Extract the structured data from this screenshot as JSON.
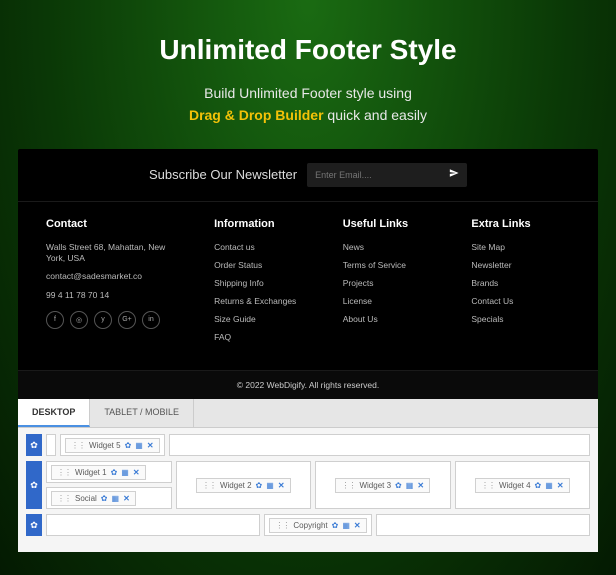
{
  "hero": {
    "title": "Unlimited Footer Style",
    "line1": "Build Unlimited Footer style using",
    "highlight": "Drag & Drop Builder",
    "line2_after": " quick and easily"
  },
  "newsletter": {
    "title": "Subscribe Our Newsletter",
    "placeholder": "Enter Email....",
    "submit_icon": "send-icon"
  },
  "footer_cols": {
    "contact": {
      "heading": "Contact",
      "address": "Walls Street 68, Mahattan, New York, USA",
      "email": "contact@sadesmarket.co",
      "phone": "99 4 11 78 70 14"
    },
    "information": {
      "heading": "Information",
      "items": [
        "Contact us",
        "Order Status",
        "Shipping Info",
        "Returns & Exchanges",
        "Size Guide",
        "FAQ"
      ]
    },
    "useful": {
      "heading": "Useful Links",
      "items": [
        "News",
        "Terms of Service",
        "Projects",
        "License",
        "About Us"
      ]
    },
    "extra": {
      "heading": "Extra Links",
      "items": [
        "Site Map",
        "Newsletter",
        "Brands",
        "Contact Us",
        "Specials"
      ]
    }
  },
  "copyright": "© 2022 WebDigify. All rights reserved.",
  "builder": {
    "tabs": [
      "DESKTOP",
      "TABLET / MOBILE"
    ],
    "active_tab": 0,
    "widgets": {
      "w5": "Widget 5",
      "w1": "Widget 1",
      "social": "Social",
      "w2": "Widget 2",
      "w3": "Widget 3",
      "w4": "Widget 4",
      "cr": "Copyright"
    },
    "ctrl_gear": "✿",
    "ctrl_grid": "▦",
    "ctrl_x": "✕"
  }
}
